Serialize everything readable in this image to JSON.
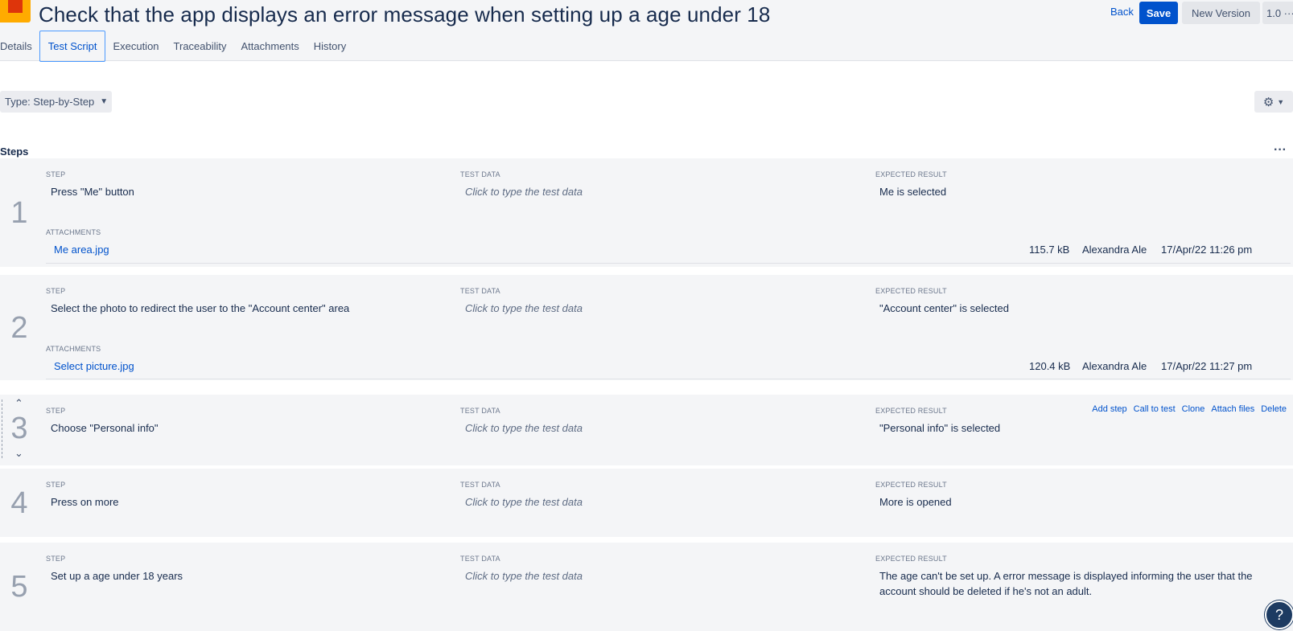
{
  "header": {
    "title": "Check that the app displays an error message when setting up a age under 18",
    "back_label": "Back",
    "save_label": "Save",
    "new_version_label": "New Version",
    "version_label": "1.0 ···"
  },
  "tabs": [
    {
      "label": "Details"
    },
    {
      "label": "Test Script"
    },
    {
      "label": "Execution"
    },
    {
      "label": "Traceability"
    },
    {
      "label": "Attachments"
    },
    {
      "label": "History"
    }
  ],
  "toolbar": {
    "type_label": "Type: Step-by-Step",
    "gear_icon": "gear-icon"
  },
  "steps_heading": "Steps",
  "column_labels": {
    "step": "STEP",
    "test_data": "TEST DATA",
    "expected": "EXPECTED RESULT",
    "attachments": "ATTACHMENTS"
  },
  "steps": [
    {
      "number": "1",
      "step": "Press \"Me\" button",
      "test_data": "Click to type the test data",
      "expected": "Me is selected",
      "attachment": {
        "name": "Me area.jpg",
        "size": "115.7 kB",
        "author": "Alexandra Ale",
        "date": "17/Apr/22 11:26 pm"
      }
    },
    {
      "number": "2",
      "step": "Select the photo to redirect the user to the \"Account center\" area",
      "test_data": "Click to type the test data",
      "expected": "\"Account center\" is selected",
      "attachment": {
        "name": "Select picture.jpg",
        "size": "120.4 kB",
        "author": "Alexandra Ale",
        "date": "17/Apr/22 11:27 pm"
      }
    },
    {
      "number": "3",
      "step": "Choose \"Personal info\"",
      "test_data": "Click to type the test data",
      "expected": "\"Personal info\" is selected"
    },
    {
      "number": "4",
      "step": "Press on more",
      "test_data": "Click to type the test data",
      "expected": "More is opened"
    },
    {
      "number": "5",
      "step": "Set up a age under 18 years",
      "test_data": "Click to type the test data",
      "expected": "The age can't be set up. A error message is displayed informing the user that the account should be deleted if he's not an adult."
    }
  ],
  "step_actions": {
    "add_step": "Add step",
    "call_to_test": "Call to test",
    "clone": "Clone",
    "attach_files": "Attach files",
    "delete": "Delete"
  },
  "help_label": "?"
}
